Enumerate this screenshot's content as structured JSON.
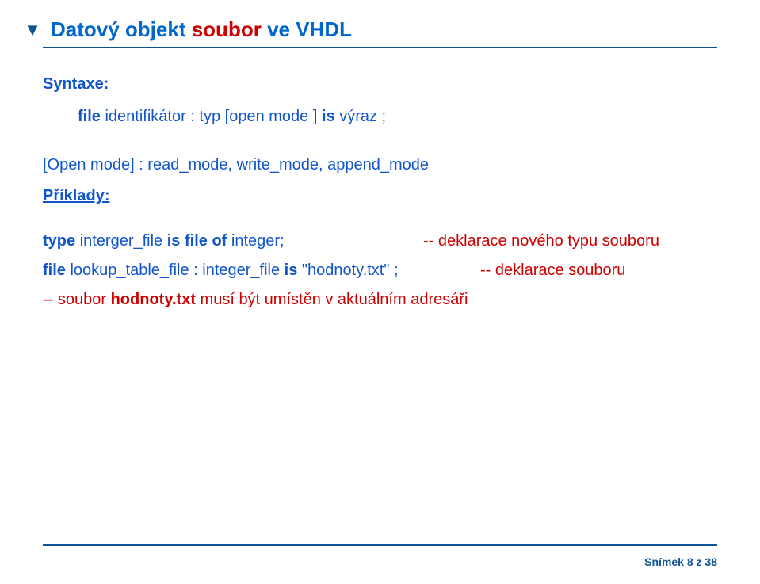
{
  "title": {
    "part1": "Datový objekt ",
    "red": "soubor ",
    "part2": "ve VHDL"
  },
  "syntax": {
    "label": "Syntaxe:",
    "kw_file": "file",
    "ident": " identifikátor : typ [open mode ] ",
    "kw_is": "is",
    "vyraz": " výraz ;"
  },
  "open_mode": {
    "label": "[Open mode] : ",
    "values": "read_mode, write_mode, append_mode"
  },
  "examples_label": "Příklady:",
  "line1": {
    "kw_type": "type",
    "body": "  interger_file ",
    "kw_is": "is",
    "kw_file": " file of",
    "semi": " integer;",
    "comment": "-- deklarace nového typu souboru"
  },
  "line2": {
    "kw_file": "file",
    "body": " lookup_table_file :  integer_file ",
    "kw_is": "is",
    "quoted": " \"hodnoty.txt\" ;",
    "comment": "-- deklarace souboru"
  },
  "line3": {
    "prefix": "-- soubor ",
    "bold": "hodnoty.txt",
    "rest": " musí být umístěn v aktuálním adresáři"
  },
  "footer": "Snímek 8 z 38"
}
